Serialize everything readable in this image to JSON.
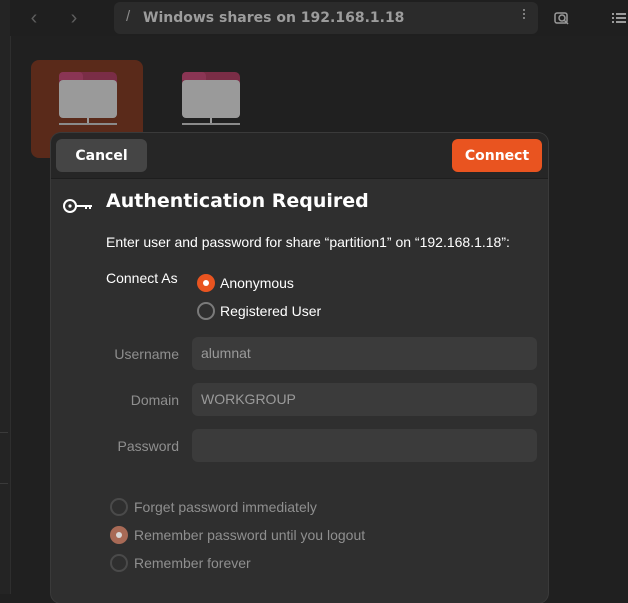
{
  "header": {
    "back_icon": "chevron-left-icon",
    "forward_icon": "chevron-right-icon",
    "path_separator": "/",
    "path_title": "Windows shares on 192.168.1.18",
    "menu_icon": "kebab-menu-icon",
    "search_icon": "search-icon",
    "view_icon": "list-view-icon"
  },
  "folders": [
    {
      "icon": "network-folder-icon",
      "selected": true
    },
    {
      "icon": "network-folder-icon",
      "selected": false
    }
  ],
  "dialog": {
    "cancel_label": "Cancel",
    "connect_label": "Connect",
    "key_icon": "key-icon",
    "title": "Authentication Required",
    "message": "Enter user and password for share “partition1” on “192.168.1.18”:",
    "connect_as_label": "Connect As",
    "connect_as_options": [
      {
        "label": "Anonymous",
        "selected": true
      },
      {
        "label": "Registered User",
        "selected": false
      }
    ],
    "fields": {
      "username_label": "Username",
      "username_value": "alumnat",
      "domain_label": "Domain",
      "domain_value": "WORKGROUP",
      "password_label": "Password",
      "password_value": ""
    },
    "remember_options": [
      {
        "label": "Forget password immediately",
        "selected": false
      },
      {
        "label": "Remember password until you logout",
        "selected": true
      },
      {
        "label": "Remember forever",
        "selected": false
      }
    ]
  },
  "colors": {
    "accent": "#e95420",
    "background": "#202020",
    "dialog": "#2f2f2f"
  }
}
